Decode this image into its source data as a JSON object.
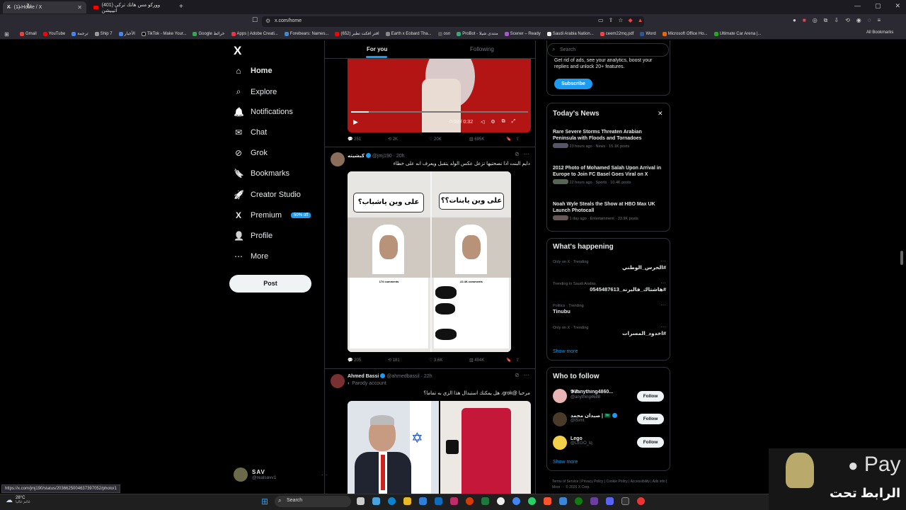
{
  "browser": {
    "tabs": [
      {
        "title": "(1) Home / X"
      },
      {
        "title": "(401) ووركو مس هاتك ترکي اتيبيشن"
      }
    ],
    "url": "x.com/home",
    "bookmarks": [
      "Gmail",
      "YouTube",
      "ترجمة",
      "Ship 7",
      "الأخبار",
      "TikTok - Make Your...",
      "Google خرائط",
      "Apps | Adobe Creati...",
      "Forebears: Names...",
      "اقتر افكت تطبر (652)",
      "Earth x Eobard Tha...",
      "osn",
      "ProBot - منتدى شيلا",
      "Scener – Ready",
      "Saudi Arabia Nation...",
      "ceem22mq.pdf",
      "Word",
      "Microsoft Office Ho...",
      "Ultimate Car Arena |..."
    ],
    "all_bookmarks": "All Bookmarks",
    "status_url": "https://x.com/jmj190/status/2036625004637397052/photo/1"
  },
  "nav": {
    "logo": "X",
    "items": [
      {
        "label": "Home",
        "icon": "home-icon",
        "glyph": "⌂"
      },
      {
        "label": "Explore",
        "icon": "search-icon",
        "glyph": "⌕"
      },
      {
        "label": "Notifications",
        "icon": "bell-icon",
        "glyph": "🔔"
      },
      {
        "label": "Chat",
        "icon": "mail-icon",
        "glyph": "✉"
      },
      {
        "label": "Grok",
        "icon": "grok-icon",
        "glyph": "⊘"
      },
      {
        "label": "Bookmarks",
        "icon": "bookmark-icon",
        "glyph": "🔖"
      },
      {
        "label": "Creator Studio",
        "icon": "rocket-icon",
        "glyph": "🚀"
      },
      {
        "label": "Premium",
        "icon": "x-icon",
        "glyph": "X"
      },
      {
        "label": "Profile",
        "icon": "person-icon",
        "glyph": "👤"
      },
      {
        "label": "More",
        "icon": "more-icon",
        "glyph": "⋯"
      }
    ],
    "premium_badge": "50% off",
    "post_label": "Post",
    "account": {
      "name": "SAV",
      "handle": "@realsavv1"
    }
  },
  "timeline": {
    "tab_for_you": "For you",
    "tab_following": "Following",
    "video_time": "0:03 / 0:32",
    "tweet0_stats": {
      "replies": "251",
      "reposts": "2K",
      "likes": "20K",
      "views": "695K"
    },
    "tweet1": {
      "name": "كبشيته",
      "handle": "@jmj190",
      "time": "20h",
      "text": "دايم البنت اذا نصحتيها تزعل عكس الولد يتقبل ويعرف انه على خطاء",
      "img_left_caption": "على وين ياشباب؟",
      "img_right_caption": "على وين يابنات؟؟",
      "comments_left": "174 comments",
      "comments_right": "22.4K comments",
      "stats": {
        "replies": "205",
        "reposts": "181",
        "likes": "3.6K",
        "views": "494K"
      }
    },
    "tweet2": {
      "name": "Ahmed Bassi",
      "handle": "@ahmedbassil",
      "time": "22h",
      "sub": "Parody account",
      "text": "مرحبا @grok، هل يمكنك استبدال هذا الزي به تماما؟"
    }
  },
  "right": {
    "search_placeholder": "Search",
    "premium_text": "Get rid of ads, see your analytics, boost your replies and unlock 20+ features.",
    "subscribe_label": "Subscribe",
    "news_title": "Today's News",
    "news": [
      {
        "title": "Rare Severe Storms Threaten Arabian Peninsula with Floods and Tornadoes",
        "meta": "23 hours ago · News · 15.1K posts"
      },
      {
        "title": "2012 Photo of Mohamed Salah Upon Arrival in Europe to Join FC Basel Goes Viral on X",
        "meta": "22 hours ago · Sports · 10.4K posts"
      },
      {
        "title": "Noah Wyle Steals the Show at HBO Max UK Launch Photocall",
        "meta": "1 day ago · Entertainment · 33.9K posts"
      }
    ],
    "happening_title": "What's happening",
    "trends": [
      {
        "meta": "Only on X · Trending",
        "name": "#الحرس_الوطني"
      },
      {
        "meta": "Trending in Saudi Arabia",
        "name": "0545487613_هاشتاك_فالبرند#"
      },
      {
        "meta": "Politics · Trending",
        "name": "Tinubu"
      },
      {
        "meta": "Only on X · Trending",
        "name": "#اخدود_المسرات"
      }
    ],
    "show_more": "Show more",
    "wtf_title": "Who to follow",
    "wtf": [
      {
        "name": "𝓨𝓔anything4860...",
        "handle": "@anything4688"
      },
      {
        "name": "صيدان محمد | 🇸🇦",
        "handle": "@lSimt"
      },
      {
        "name": "Lego",
        "handle": "@LEGO_lq"
      }
    ],
    "follow_label": "Follow",
    "footer": "Terms of Service  |  Privacy Policy  |  Cookie Policy  |  Accessibility  |  Ads info  |  More ···  © 2026 X Corp."
  },
  "taskbar": {
    "weather_temp": "28°C",
    "weather_desc": "غائم غالبا",
    "search": "Search"
  },
  "overlay": {
    "text": "الرابط تحت",
    "pay": "Pay"
  },
  "colors": {
    "accent": "#1d9bf0",
    "bg": "#000000",
    "border": "#2f3336"
  }
}
